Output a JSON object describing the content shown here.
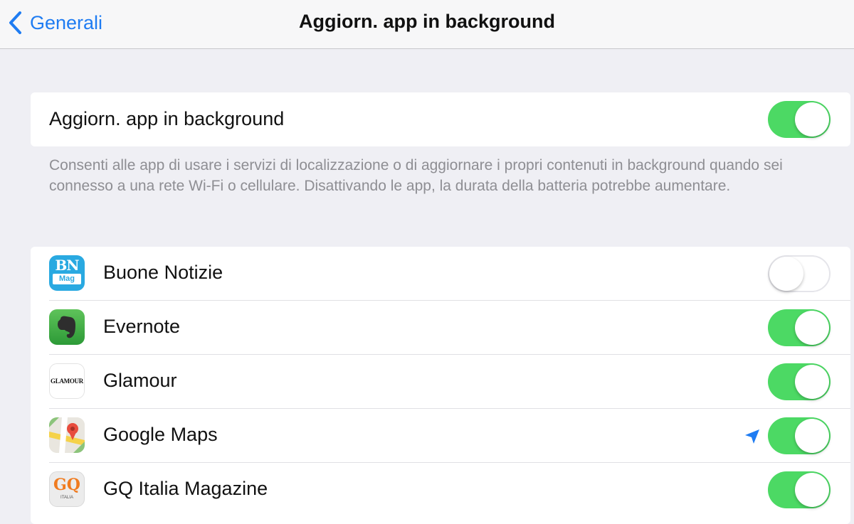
{
  "navbar": {
    "back_label": "Generali",
    "title": "Aggiorn. app in background"
  },
  "master": {
    "label": "Aggiorn. app in background",
    "enabled": true
  },
  "footer_note": "Consenti alle app di usare i servizi di localizzazione o di aggiornare i propri contenuti in background quando sei connesso a una rete Wi-Fi o cellulare. Disattivando le app, la durata della batteria potrebbe aumentare.",
  "apps": [
    {
      "name": "Buone Notizie",
      "icon": "buone-notizie-app-icon",
      "icon_text_top": "BN",
      "icon_text_bottom": "Mag",
      "enabled": false
    },
    {
      "name": "Evernote",
      "icon": "evernote-app-icon",
      "enabled": true
    },
    {
      "name": "Glamour",
      "icon": "glamour-app-icon",
      "icon_text": "GLAMOUR",
      "enabled": true
    },
    {
      "name": "Google Maps",
      "icon": "google-maps-app-icon",
      "enabled": true,
      "location_indicator": true
    },
    {
      "name": "GQ Italia Magazine",
      "icon": "gq-italia-app-icon",
      "icon_text": "GQ",
      "icon_subtext": "ITALIA",
      "enabled": true
    }
  ],
  "colors": {
    "accent": "#1f7cf2",
    "toggle_on": "#4cd964",
    "background": "#efeff4",
    "footer_text": "#8e8e93"
  }
}
